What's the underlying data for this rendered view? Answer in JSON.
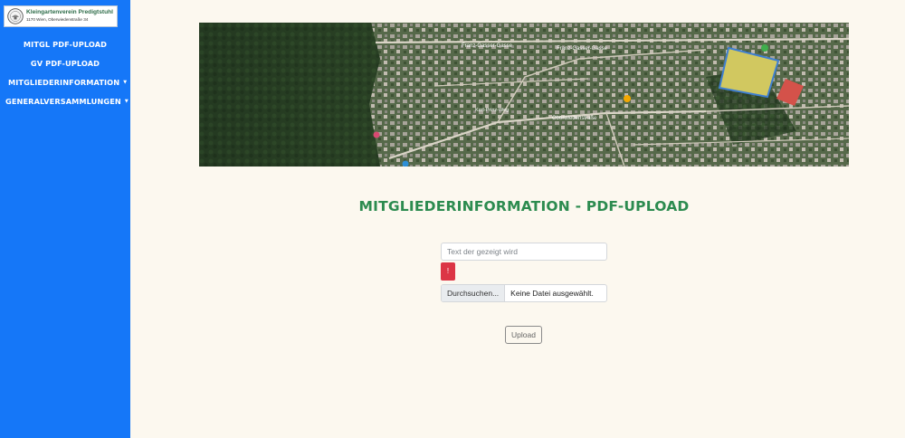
{
  "sidebar": {
    "logo": {
      "title": "Kleingartenverein Predigtstuhl",
      "subtitle": "1170 Wien, Oberwiedenstraße 34"
    },
    "items": [
      {
        "label": "MITGL PDF-UPLOAD",
        "has_dropdown": false
      },
      {
        "label": "GV PDF-UPLOAD",
        "has_dropdown": false
      },
      {
        "label": "MITGLIEDERINFORMATION",
        "has_dropdown": true
      },
      {
        "label": "GENERALVERSAMMLUNGEN",
        "has_dropdown": true
      }
    ],
    "background_color": "#1577f8"
  },
  "map": {
    "street_labels": [
      "Franz-Gasser-Gasse",
      "Franz-Gasser-Gasse",
      "Oberwiedenstraße",
      "Karl-Prinz-Weg"
    ]
  },
  "main": {
    "title": "MITGLIEDERINFORMATION - PDF-UPLOAD",
    "title_color": "#2c8b4f",
    "text_input": {
      "value": "",
      "placeholder": "Text der gezeigt wird"
    },
    "alert_button": {
      "label": "!",
      "color": "#dc3545"
    },
    "file_input": {
      "browse_label": "Durchsuchen...",
      "status": "Keine Datei ausgewählt."
    },
    "upload_button": {
      "label": "Upload"
    }
  },
  "icons": [
    "club-seal-icon",
    "caret-down-icon",
    "map-pin-icon"
  ]
}
